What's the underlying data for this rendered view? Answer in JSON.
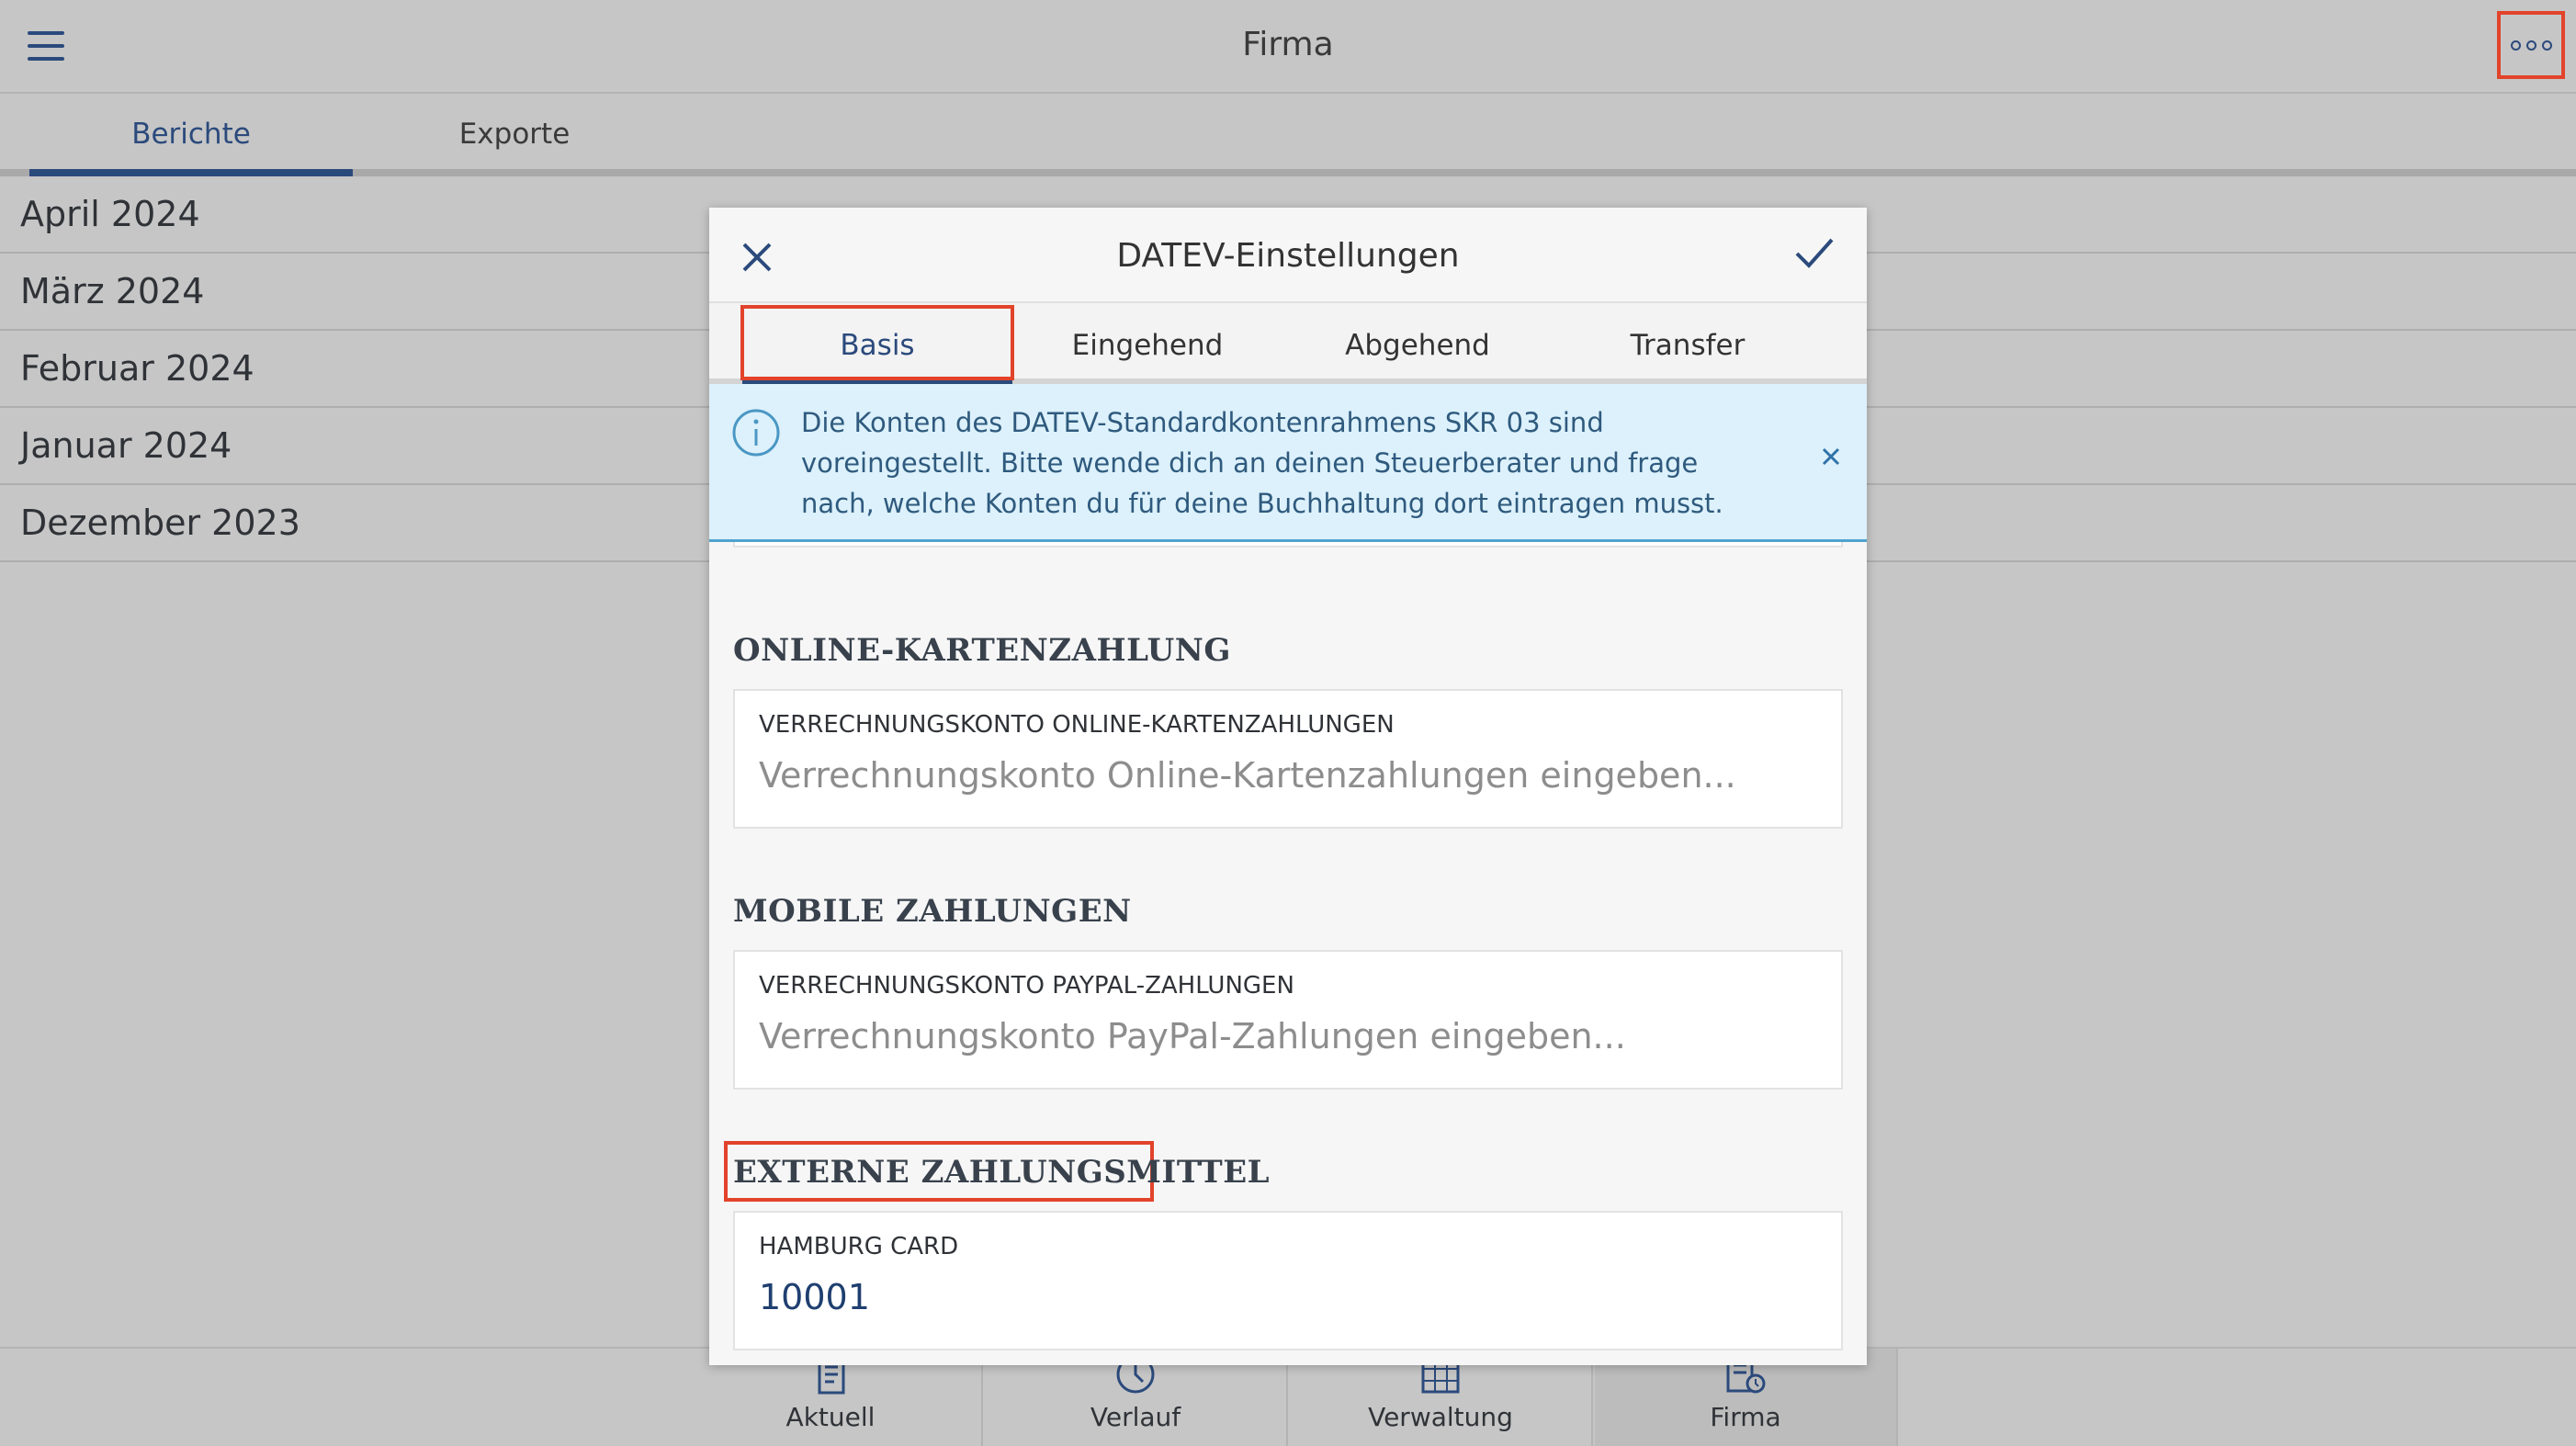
{
  "header": {
    "title": "Firma",
    "menu_icon": "hamburger-icon",
    "more_icon": "more-options-icon"
  },
  "tabs": [
    {
      "label": "Berichte",
      "active": true
    },
    {
      "label": "Exporte",
      "active": false
    }
  ],
  "months": [
    "April 2024",
    "März 2024",
    "Februar 2024",
    "Januar 2024",
    "Dezember 2023"
  ],
  "bottom_nav": [
    {
      "label": "Aktuell",
      "icon": "receipt-icon"
    },
    {
      "label": "Verlauf",
      "icon": "clock-icon"
    },
    {
      "label": "Verwaltung",
      "icon": "grid-icon"
    },
    {
      "label": "Firma",
      "icon": "company-report-icon",
      "selected": true
    }
  ],
  "dialog": {
    "title": "DATEV-Einstellungen",
    "close_icon": "close-icon",
    "confirm_icon": "checkmark-icon",
    "tabs": [
      {
        "label": "Basis",
        "active": true
      },
      {
        "label": "Eingehend",
        "active": false
      },
      {
        "label": "Abgehend",
        "active": false
      },
      {
        "label": "Transfer",
        "active": false
      }
    ],
    "info": {
      "icon": "info-icon",
      "text": "Die Konten des DATEV-Standardkontenrahmens SKR 03 sind voreingestellt. Bitte wende dich an deinen Steuerberater und frage nach, welche Konten du für deine Buchhaltung dort eintragen musst."
    },
    "sections": [
      {
        "title": "ONLINE-KARTENZAHLUNG",
        "field": {
          "label": "VERRECHNUNGSKONTO ONLINE-KARTENZAHLUNGEN",
          "value": "",
          "placeholder": "Verrechnungskonto Online-Kartenzahlungen eingeben..."
        }
      },
      {
        "title": "MOBILE ZAHLUNGEN",
        "field": {
          "label": "VERRECHNUNGSKONTO PAYPAL-ZAHLUNGEN",
          "value": "",
          "placeholder": "Verrechnungskonto PayPal-Zahlungen eingeben..."
        }
      },
      {
        "title": "EXTERNE ZAHLUNGSMITTEL",
        "field": {
          "label": "HAMBURG CARD",
          "value": "10001",
          "placeholder": ""
        }
      }
    ]
  },
  "colors": {
    "accent": "#2b4a7c",
    "highlight": "#e2432b",
    "info_bg": "#dcf1fb",
    "overlay_bg": "#c6c6c6"
  }
}
